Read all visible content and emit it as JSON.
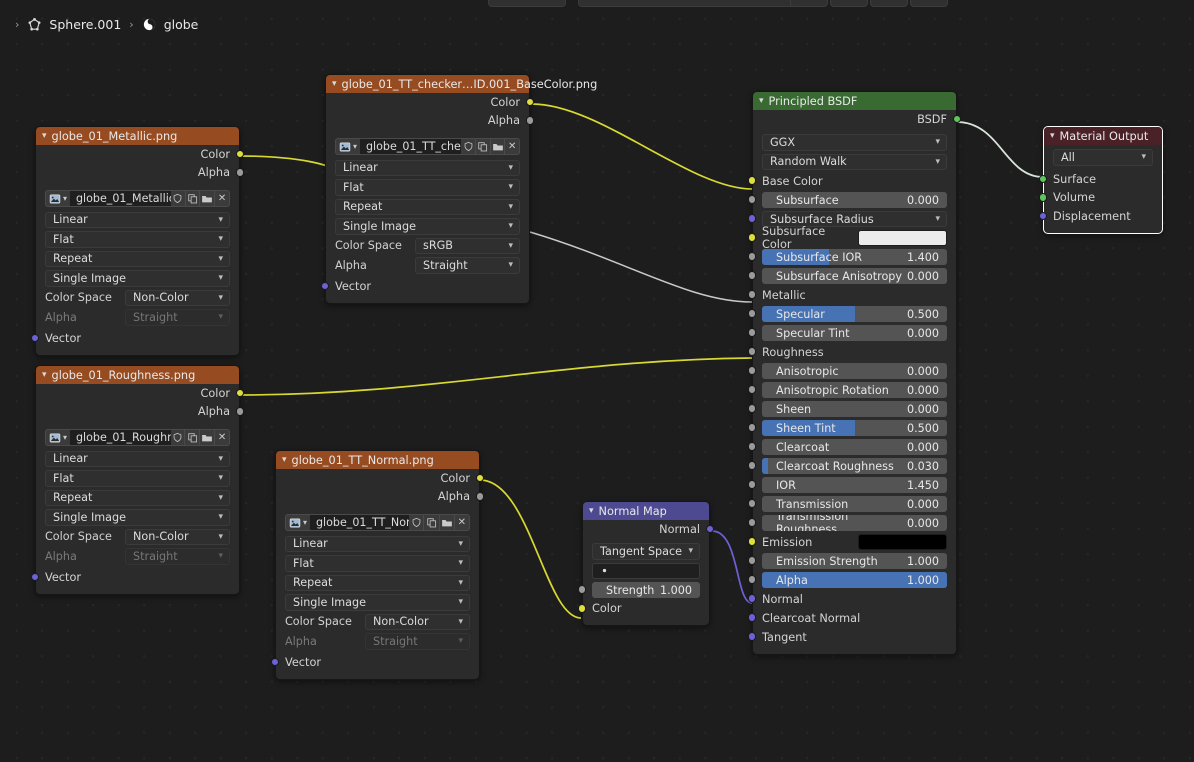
{
  "editor": {
    "background_color": "#1d1d1d",
    "grid_dot_color": "#262626"
  },
  "breadcrumb": {
    "items": [
      {
        "icon": "mesh-data-icon",
        "label": "Sphere.001"
      },
      {
        "icon": "material-data-icon",
        "label": "globe"
      }
    ]
  },
  "colors": {
    "header_texture": "#964b20",
    "header_shader": "#386a32",
    "header_output": "#4a2127",
    "header_vector": "#4d4a91",
    "socket_color": "#dede3c",
    "socket_float": "#9b9b9b",
    "socket_vector": "#6c61d6",
    "socket_shader": "#60c360",
    "slider_fill": "#4772b3"
  },
  "nodes": {
    "metallic_tex": {
      "title": "globe_01_Metallic.png",
      "outputs": [
        {
          "label": "Color",
          "socket": "color"
        },
        {
          "label": "Alpha",
          "socket": "float"
        }
      ],
      "datablock": {
        "name": "globe_01_Metallic...",
        "buttons": [
          "shield-icon",
          "copy-icon",
          "folder-icon",
          "close-icon"
        ]
      },
      "selects": [
        "Linear",
        "Flat",
        "Repeat",
        "Single Image"
      ],
      "color_space": {
        "label": "Color Space",
        "value": "Non-Color"
      },
      "alpha": {
        "label": "Alpha",
        "value": "Straight",
        "disabled": true
      },
      "inputs": [
        {
          "label": "Vector",
          "socket": "vector"
        }
      ]
    },
    "roughness_tex": {
      "title": "globe_01_Roughness.png",
      "outputs": [
        {
          "label": "Color",
          "socket": "color"
        },
        {
          "label": "Alpha",
          "socket": "float"
        }
      ],
      "datablock": {
        "name": "globe_01_Roughn...",
        "buttons": [
          "shield-icon",
          "copy-icon",
          "folder-icon",
          "close-icon"
        ]
      },
      "selects": [
        "Linear",
        "Flat",
        "Repeat",
        "Single Image"
      ],
      "color_space": {
        "label": "Color Space",
        "value": "Non-Color"
      },
      "alpha": {
        "label": "Alpha",
        "value": "Straight",
        "disabled": true
      },
      "inputs": [
        {
          "label": "Vector",
          "socket": "vector"
        }
      ]
    },
    "basecolor_tex": {
      "title": "globe_01_TT_checker…ID.001_BaseColor.png",
      "outputs": [
        {
          "label": "Color",
          "socket": "color"
        },
        {
          "label": "Alpha",
          "socket": "float"
        }
      ],
      "datablock": {
        "name": "globe_01_TT_chec...",
        "buttons": [
          "shield-icon",
          "copy-icon",
          "folder-icon",
          "close-icon"
        ]
      },
      "selects": [
        "Linear",
        "Flat",
        "Repeat",
        "Single Image"
      ],
      "color_space": {
        "label": "Color Space",
        "value": "sRGB"
      },
      "alpha": {
        "label": "Alpha",
        "value": "Straight",
        "disabled": false
      },
      "inputs": [
        {
          "label": "Vector",
          "socket": "vector"
        }
      ]
    },
    "normal_tex": {
      "title": "globe_01_TT_Normal.png",
      "outputs": [
        {
          "label": "Color",
          "socket": "color"
        },
        {
          "label": "Alpha",
          "socket": "float"
        }
      ],
      "datablock": {
        "name": "globe_01_TT_Nor...",
        "buttons": [
          "shield-icon",
          "copy-icon",
          "folder-icon",
          "close-icon"
        ]
      },
      "selects": [
        "Linear",
        "Flat",
        "Repeat",
        "Single Image"
      ],
      "color_space": {
        "label": "Color Space",
        "value": "Non-Color"
      },
      "alpha": {
        "label": "Alpha",
        "value": "Straight",
        "disabled": true
      },
      "inputs": [
        {
          "label": "Vector",
          "socket": "vector"
        }
      ]
    },
    "normal_map": {
      "title": "Normal Map",
      "outputs": [
        {
          "label": "Normal",
          "socket": "vector"
        }
      ],
      "space": "Tangent Space",
      "uv_map": "",
      "strength": {
        "label": "Strength",
        "value": "1.000"
      },
      "inputs": [
        {
          "label": "Color",
          "socket": "color"
        }
      ]
    },
    "principled": {
      "title": "Principled BSDF",
      "outputs": [
        {
          "label": "BSDF",
          "socket": "shader"
        }
      ],
      "distribution": "GGX",
      "subsurface_method": "Random Walk",
      "rows": [
        {
          "label": "Base Color",
          "type": "plain",
          "socket": "color"
        },
        {
          "label": "Subsurface",
          "type": "slider",
          "value": "0.000",
          "fill": 0,
          "socket": "float"
        },
        {
          "label": "Subsurface Radius",
          "type": "select",
          "socket": "vector"
        },
        {
          "label": "Subsurface Color",
          "type": "swatch",
          "color": "#ebebeb",
          "socket": "color"
        },
        {
          "label": "Subsurface IOR",
          "type": "slider",
          "value": "1.400",
          "fill": 36,
          "socket": "float"
        },
        {
          "label": "Subsurface Anisotropy",
          "type": "slider",
          "value": "0.000",
          "fill": 0,
          "socket": "float"
        },
        {
          "label": "Metallic",
          "type": "plain",
          "socket": "float"
        },
        {
          "label": "Specular",
          "type": "slider",
          "value": "0.500",
          "fill": 50,
          "socket": "float"
        },
        {
          "label": "Specular Tint",
          "type": "slider",
          "value": "0.000",
          "fill": 0,
          "socket": "float"
        },
        {
          "label": "Roughness",
          "type": "plain",
          "socket": "float"
        },
        {
          "label": "Anisotropic",
          "type": "slider",
          "value": "0.000",
          "fill": 0,
          "socket": "float"
        },
        {
          "label": "Anisotropic Rotation",
          "type": "slider",
          "value": "0.000",
          "fill": 0,
          "socket": "float"
        },
        {
          "label": "Sheen",
          "type": "slider",
          "value": "0.000",
          "fill": 0,
          "socket": "float"
        },
        {
          "label": "Sheen Tint",
          "type": "slider",
          "value": "0.500",
          "fill": 50,
          "socket": "float"
        },
        {
          "label": "Clearcoat",
          "type": "slider",
          "value": "0.000",
          "fill": 0,
          "socket": "float"
        },
        {
          "label": "Clearcoat Roughness",
          "type": "slider",
          "value": "0.030",
          "fill": 3,
          "socket": "float"
        },
        {
          "label": "IOR",
          "type": "slider",
          "value": "1.450",
          "fill": 0,
          "socket": "float"
        },
        {
          "label": "Transmission",
          "type": "slider",
          "value": "0.000",
          "fill": 0,
          "socket": "float"
        },
        {
          "label": "Transmission Roughness",
          "type": "slider",
          "value": "0.000",
          "fill": 0,
          "socket": "float"
        },
        {
          "label": "Emission",
          "type": "swatch",
          "color": "#000000",
          "socket": "color"
        },
        {
          "label": "Emission Strength",
          "type": "slider",
          "value": "1.000",
          "fill": 0,
          "socket": "float"
        },
        {
          "label": "Alpha",
          "type": "slider",
          "value": "1.000",
          "fill": 100,
          "socket": "float"
        },
        {
          "label": "Normal",
          "type": "plain",
          "socket": "vector"
        },
        {
          "label": "Clearcoat Normal",
          "type": "plain",
          "socket": "vector"
        },
        {
          "label": "Tangent",
          "type": "plain",
          "socket": "vector"
        }
      ]
    },
    "material_output": {
      "title": "Material Output",
      "target": "All",
      "inputs": [
        {
          "label": "Surface",
          "socket": "shader"
        },
        {
          "label": "Volume",
          "socket": "shader"
        },
        {
          "label": "Displacement",
          "socket": "vector"
        }
      ],
      "selected": true
    }
  }
}
